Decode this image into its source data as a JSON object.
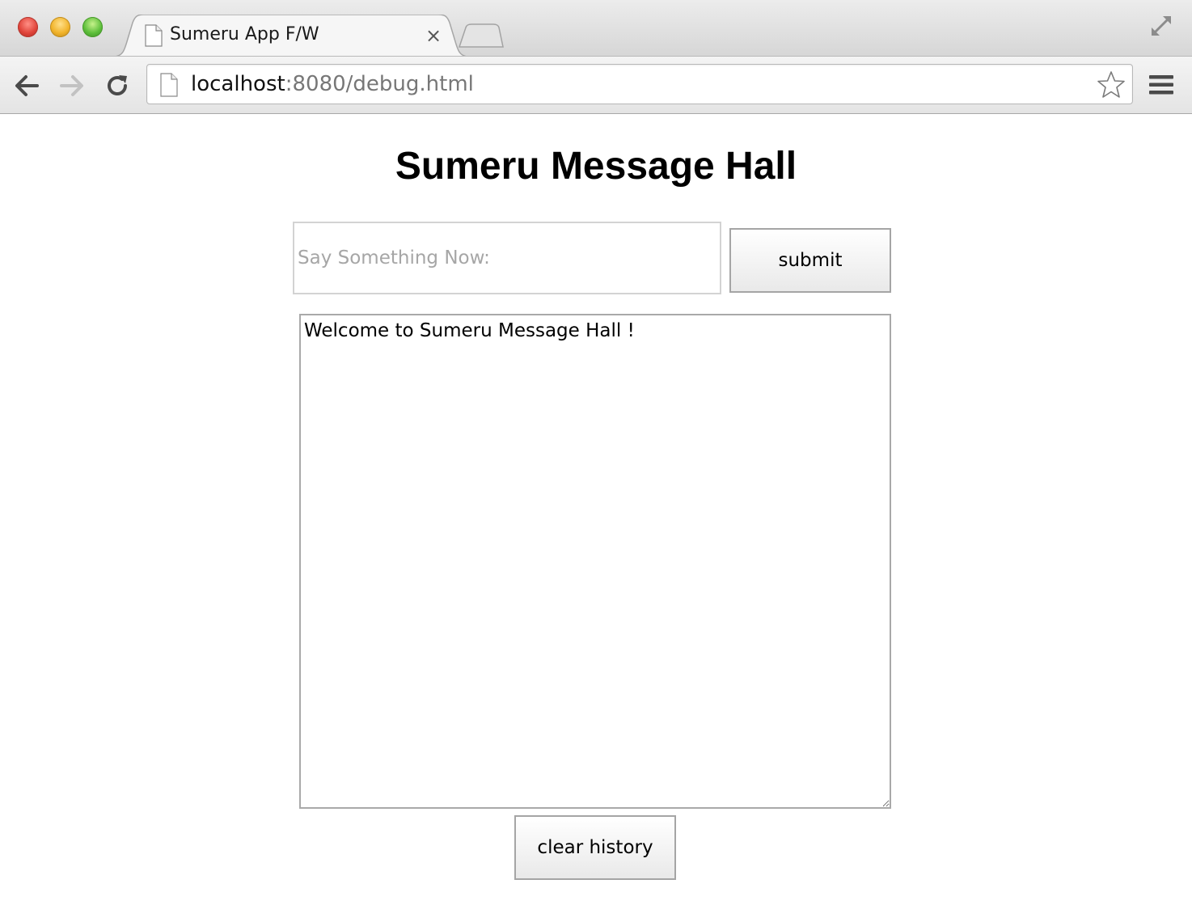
{
  "browser": {
    "tab_title": "Sumeru App F/W",
    "tab_close": "×",
    "url_host": "localhost",
    "url_rest": ":8080/debug.html"
  },
  "page": {
    "title": "Sumeru Message Hall",
    "input_placeholder": "Say Something Now:",
    "input_value": "",
    "submit_label": "submit",
    "history_text": "Welcome to Sumeru Message Hall !",
    "clear_label": "clear history"
  },
  "icons": {
    "close_window": "close-window-icon",
    "minimize_window": "minimize-window-icon",
    "zoom_window": "zoom-window-icon",
    "tab_favicon": "page-icon",
    "tab_close": "close-icon",
    "new_tab": "new-tab-icon",
    "fullscreen": "fullscreen-icon",
    "back": "back-arrow-icon",
    "forward": "forward-arrow-icon",
    "reload": "reload-icon",
    "page_info": "page-icon",
    "bookmark": "star-icon",
    "menu": "hamburger-menu-icon"
  },
  "colors": {
    "close_red": "#e0443a",
    "minimize_yellow": "#f1b32a",
    "zoom_green": "#5cbe3a",
    "url_host": "#111111",
    "url_rest": "#777777",
    "placeholder": "#a6a6a6"
  }
}
